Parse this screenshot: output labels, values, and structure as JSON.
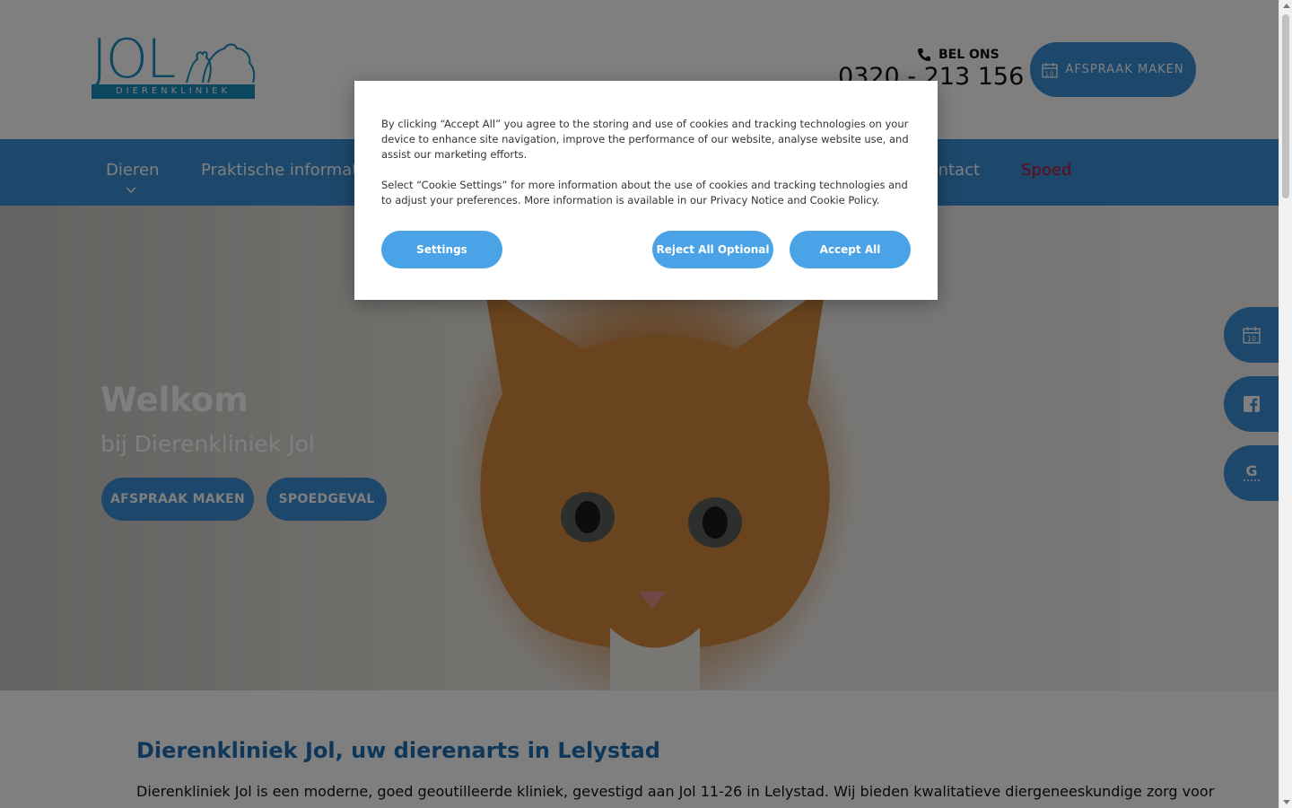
{
  "header": {
    "logo_text": "JOL",
    "logo_subtitle": "DIERENKLINIEK",
    "phone_label": "BEL ONS",
    "phone_number": "0320 - 213 156",
    "appointment_button": "AFSPRAAK MAKEN",
    "calendar_day": "10"
  },
  "nav": {
    "items": [
      {
        "label": "Dieren"
      },
      {
        "label": "Praktische informatie"
      },
      {
        "label": "Contact"
      },
      {
        "label": "Spoed"
      }
    ]
  },
  "hero": {
    "title": "Welkom",
    "subtitle": "bij Dierenkliniek Jol",
    "buttons": [
      {
        "label": "AFSPRAAK MAKEN"
      },
      {
        "label": "SPOEDGEVAL"
      }
    ]
  },
  "side_buttons": [
    {
      "icon": "calendar-icon",
      "text": "10"
    },
    {
      "icon": "facebook-icon"
    },
    {
      "icon": "google-review-icon"
    }
  ],
  "content": {
    "title": "Dierenkliniek Jol, uw dierenarts in Lelystad",
    "text": "Dierenkliniek Jol is een moderne, goed geoutilleerde kliniek, gevestigd aan Jol 11-26 in Lelystad. Wij bieden kwalitatieve diergeneeskundige zorg voor"
  },
  "cookie_dialog": {
    "paragraph1": "By clicking “Accept All” you agree to the storing and use of cookies and tracking technologies on your device to enhance site navigation, improve the performance of our website, analyse website use, and assist our marketing efforts.",
    "paragraph2": "Select “Cookie Settings” for more information about the use of cookies and tracking technologies and to adjust your preferences. More information is available in our Privacy Notice and Cookie Policy.",
    "settings_button": "Settings",
    "reject_button": "Reject All Optional",
    "accept_button": "Accept All"
  },
  "colors": {
    "brand_blue": "#3a8fd6",
    "logo_blue": "#1a8cbf",
    "emergency_red": "#c8102e",
    "cookie_button": "#4aa3e6"
  }
}
